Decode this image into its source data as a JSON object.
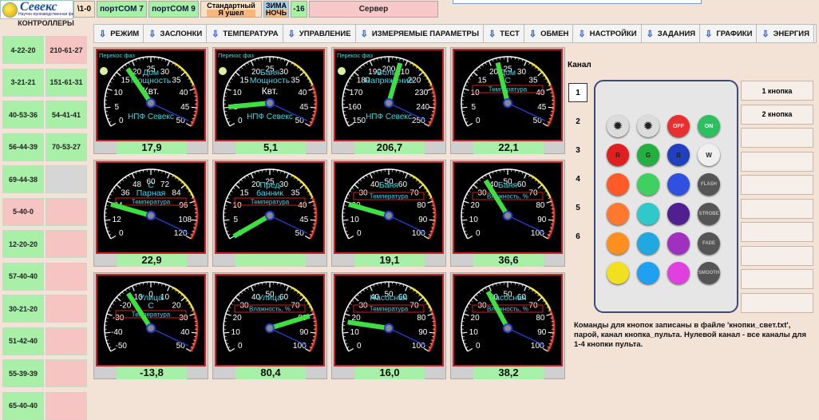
{
  "topbar": {
    "logo_text": "Севекс",
    "logo_sub": "Научно-производственная фирма",
    "cells": [
      {
        "label": "\\1-0",
        "type": "plain"
      },
      {
        "label": "портCOM 7",
        "type": "green"
      },
      {
        "label": "портCOM 9",
        "type": "green"
      },
      {
        "label": "Стандартный",
        "label2": "Я ушел",
        "type": "green2"
      },
      {
        "label": "ЗИМА",
        "label2": "НОЧЬ",
        "type": "blue"
      },
      {
        "label": "-16",
        "type": "green"
      },
      {
        "label": "Сервер",
        "type": "pink"
      }
    ]
  },
  "sidebar": {
    "header": "КОНТРОЛЛЕРЫ",
    "left": [
      {
        "label": "4-22-20",
        "color": "green"
      },
      {
        "label": "3-21-21",
        "color": "green"
      },
      {
        "label": "40-53-36",
        "color": "green"
      },
      {
        "label": "56-44-39",
        "color": "green"
      },
      {
        "label": "69-44-38",
        "color": "green"
      },
      {
        "label": "5-40-0",
        "color": "pink"
      },
      {
        "label": "12-20-20",
        "color": "green"
      },
      {
        "label": "57-40-40",
        "color": "green"
      },
      {
        "label": "30-21-20",
        "color": "green"
      },
      {
        "label": "51-42-40",
        "color": "green"
      },
      {
        "label": "55-39-39",
        "color": "green"
      },
      {
        "label": "65-40-40",
        "color": "green"
      }
    ],
    "right": [
      {
        "label": "210-61-27",
        "color": "pink"
      },
      {
        "label": "151-61-31",
        "color": "green"
      },
      {
        "label": "54-41-41",
        "color": "green"
      },
      {
        "label": "70-53-27",
        "color": "green"
      },
      {
        "label": "",
        "color": "gray"
      },
      {
        "label": "",
        "color": "pink"
      },
      {
        "label": "",
        "color": "pink"
      },
      {
        "label": "",
        "color": "pink"
      },
      {
        "label": "",
        "color": "pink"
      },
      {
        "label": "",
        "color": "pink"
      },
      {
        "label": "",
        "color": "pink"
      },
      {
        "label": "",
        "color": "pink"
      }
    ]
  },
  "nav": [
    "РЕЖИМ",
    "ЗАСЛОНКИ",
    "ТЕМПЕРАТУРА",
    "УПРАВЛЕНИЕ",
    "ИЗМЕРЯЕМЫЕ ПАРАМЕТРЫ",
    "ТЕСТ",
    "ОБМЕН",
    "НАСТРОЙКИ",
    "ЗАДАНИЯ",
    "ГРАФИКИ",
    "ЭНЕРГИЯ"
  ],
  "gauges": [
    {
      "title": "Дом",
      "title2": "Мощность",
      "unit": "Квт.",
      "brand": "НПФ Севекс",
      "corner": "Перекос фаз",
      "min": 0,
      "max": 50,
      "ticks": [
        0,
        5,
        10,
        15,
        20,
        25,
        30,
        35,
        40,
        45,
        50
      ],
      "needle": 17.9,
      "value": "17,9"
    },
    {
      "title": "Баня",
      "title2": "Мощность",
      "unit": "Квт.",
      "brand": "НПФ Севекс",
      "corner": "Перекос фаз",
      "min": 0,
      "max": 50,
      "ticks": [
        0,
        5,
        10,
        15,
        20,
        25,
        30,
        35,
        40,
        45,
        50
      ],
      "needle": 5.1,
      "value": "5,1"
    },
    {
      "title": "Вольт.",
      "title2": "Напряжение",
      "unit": "",
      "brand": "НПФ Севекс",
      "corner": "Перекос фаз",
      "min": 150,
      "max": 250,
      "ticks": [
        150,
        160,
        170,
        180,
        190,
        200,
        210,
        220,
        230,
        240,
        250
      ],
      "needle": 206.7,
      "value": "206,7"
    },
    {
      "title": "Дом",
      "title2": "С",
      "label": "Температура",
      "min": 0,
      "max": 50,
      "ticks": [
        0,
        5,
        10,
        15,
        20,
        25,
        30,
        35,
        40,
        45,
        50
      ],
      "needle": 22.1,
      "value": "22,1"
    },
    {
      "title": "С",
      "title2": "Парная",
      "label": "Температура",
      "min": 0,
      "max": 120,
      "ticks": [
        0,
        12,
        24,
        36,
        48,
        60,
        72,
        84,
        96,
        108,
        120
      ],
      "needle": 22.9,
      "value": "22,9"
    },
    {
      "title": "Пред",
      "title2": "банник",
      "label": "Температура",
      "min": 0,
      "max": 50,
      "ticks": [
        0,
        5,
        10,
        15,
        20,
        25,
        30,
        35,
        40,
        45,
        50
      ],
      "needle": 0,
      "value": ""
    },
    {
      "title": "Баня",
      "title2": "",
      "label": "Температура",
      "min": 0,
      "max": 100,
      "ticks": [
        0,
        10,
        20,
        30,
        40,
        50,
        60,
        70,
        80,
        90,
        100
      ],
      "needle": 19.1,
      "value": "19,1"
    },
    {
      "title": "Баня",
      "title2": "",
      "label": "Влажность, %",
      "min": 0,
      "max": 100,
      "ticks": [
        0,
        10,
        20,
        30,
        40,
        50,
        60,
        70,
        80,
        90,
        100
      ],
      "needle": 36.6,
      "value": "36,6"
    },
    {
      "title": "Улица",
      "title2": "С",
      "label": "Температура",
      "min": -50,
      "max": 50,
      "ticks": [
        -50,
        -40,
        -30,
        -20,
        -10,
        0,
        10,
        20,
        30,
        40,
        50
      ],
      "needle": -13.8,
      "value": "-13,8"
    },
    {
      "title": "Улица",
      "title2": "",
      "label": "Влажность, %",
      "min": 0,
      "max": 100,
      "ticks": [
        0,
        10,
        20,
        30,
        40,
        50,
        60,
        70,
        80,
        90,
        100
      ],
      "needle": 80.4,
      "value": "80,4"
    },
    {
      "title": "Насосная",
      "title2": "",
      "label": "Температура",
      "min": 0,
      "max": 100,
      "ticks": [
        0,
        10,
        20,
        30,
        40,
        50,
        60,
        70,
        80,
        90,
        100
      ],
      "needle": 16.0,
      "value": "16,0"
    },
    {
      "title": "Насосная",
      "title2": "",
      "label": "Влажность, %",
      "min": 0,
      "max": 100,
      "ticks": [
        0,
        10,
        20,
        30,
        40,
        50,
        60,
        70,
        80,
        90,
        100
      ],
      "needle": 38.2,
      "value": "38,2"
    }
  ],
  "channel": {
    "label": "Канал",
    "buttons": [
      "1",
      "2",
      "3",
      "4",
      "5",
      "6"
    ],
    "selected": "1"
  },
  "remote": {
    "top": [
      {
        "icon": "brightness-up",
        "color": "#dcdcdc"
      },
      {
        "icon": "brightness-down",
        "color": "#dcdcdc"
      },
      {
        "icon": "off",
        "label": "OFF",
        "color": "#e83030"
      },
      {
        "icon": "on",
        "label": "ON",
        "color": "#2ec060"
      }
    ],
    "rows": [
      [
        {
          "label": "R",
          "color": "#e02020"
        },
        {
          "label": "G",
          "color": "#22b040"
        },
        {
          "label": "B",
          "color": "#2040c0"
        },
        {
          "label": "W",
          "color": "#f0f0f0"
        }
      ],
      [
        {
          "label": "",
          "color": "#ff5a28"
        },
        {
          "label": "",
          "color": "#40d060"
        },
        {
          "label": "",
          "color": "#3050e0"
        },
        {
          "label": "FLASH",
          "color": "#555"
        }
      ],
      [
        {
          "label": "",
          "color": "#ff7830"
        },
        {
          "label": "",
          "color": "#30c8c8"
        },
        {
          "label": "",
          "color": "#502090"
        },
        {
          "label": "STROBE",
          "color": "#555"
        }
      ],
      [
        {
          "label": "",
          "color": "#ff9020"
        },
        {
          "label": "",
          "color": "#20a8e0"
        },
        {
          "label": "",
          "color": "#a030c0"
        },
        {
          "label": "FADE",
          "color": "#555"
        }
      ],
      [
        {
          "label": "",
          "color": "#f0e020"
        },
        {
          "label": "",
          "color": "#20a0f0"
        },
        {
          "label": "",
          "color": "#e040e0"
        },
        {
          "label": "SMOOTH",
          "color": "#555"
        }
      ]
    ]
  },
  "key_buttons": [
    "1 кнопка",
    "2 кнопка",
    "",
    "",
    "",
    "",
    "",
    "",
    "",
    ""
  ],
  "note": "Команды для кнопок записаны в файле 'кнопки_свет.txt', парой, канал кнопка_пульта. Нулевой канал - все каналы для 1-4 кнопки пульта."
}
